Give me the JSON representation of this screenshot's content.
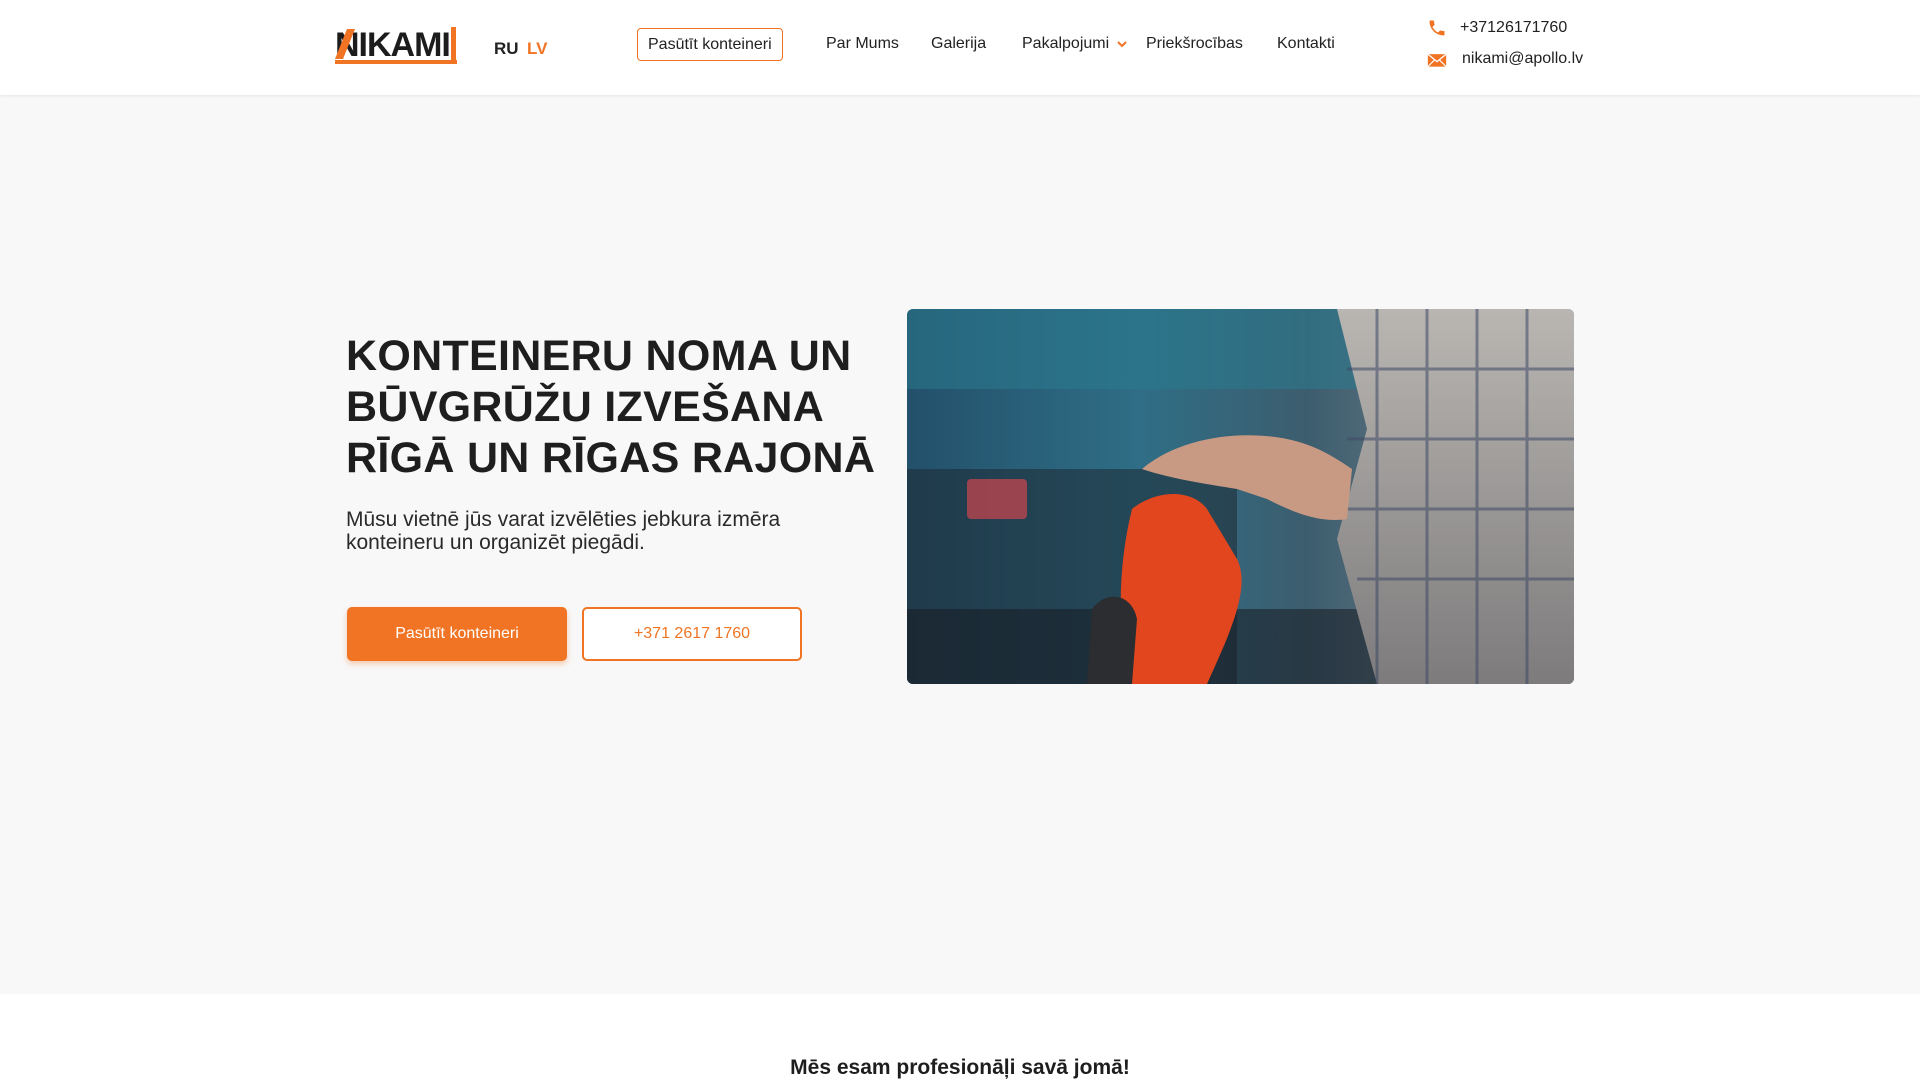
{
  "header": {
    "logo_text": "NIKAMI",
    "languages": [
      "RU",
      "LV"
    ],
    "active_language": "LV",
    "order_button": "Pasūtīt konteineri",
    "nav": [
      "Par Mums",
      "Galerija",
      "Pakalpojumi",
      "Priekšrocības",
      "Kontakti"
    ],
    "phone": "+37126171760",
    "email": "nikami@apollo.lv"
  },
  "hero": {
    "title": "KONTEINERU NOMA UN BŪVGRŪŽU IZVEŠANA RĪGĀ UN RĪGAS RAJONĀ",
    "subtitle": "Mūsu vietnē jūs varat izvēlēties jebkura izmēra konteineru un organizēt piegādi.",
    "primary_button": "Pasūtīt konteineri",
    "phone_button": "+371 2617 1760"
  },
  "section": {
    "heading": "Mēs esam profesionāļi savā jomā!"
  },
  "colors": {
    "accent": "#f07424",
    "text": "#1e1e1e",
    "background": "#f8f8f8"
  },
  "icons": {
    "phone": "phone-icon",
    "email": "envelope-icon",
    "dropdown": "chevron-down-icon"
  }
}
